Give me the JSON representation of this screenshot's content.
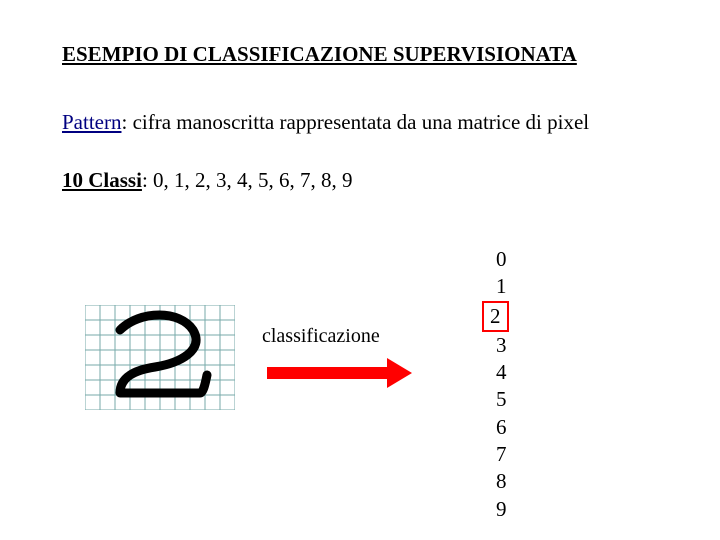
{
  "title": "ESEMPIO DI CLASSIFICAZIONE SUPERVISIONATA",
  "pattern": {
    "label": "Pattern",
    "text": ": cifra manoscritta rappresentata da una matrice di pixel"
  },
  "classi": {
    "label": "10 Classi",
    "text": ": 0, 1, 2, 3, 4, 5, 6, 7, 8, 9"
  },
  "classification_label": "classificazione",
  "grid": {
    "rows": 7,
    "cols": 10,
    "cell": 15
  },
  "arrow_color": "#ff0000",
  "box_color": "#ff0000",
  "digits": [
    "0",
    "1",
    "2",
    "3",
    "4",
    "5",
    "6",
    "7",
    "8",
    "9"
  ],
  "selected_digit": "2"
}
